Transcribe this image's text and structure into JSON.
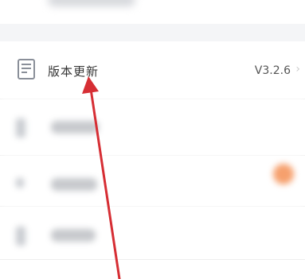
{
  "settings": {
    "update_row": {
      "label": "版本更新",
      "version": "V3.2.6",
      "icon": "document-icon"
    }
  },
  "colors": {
    "annotation_arrow": "#d62e34",
    "badge": "#f6a06d",
    "section_gap": "#f4f5f7"
  }
}
